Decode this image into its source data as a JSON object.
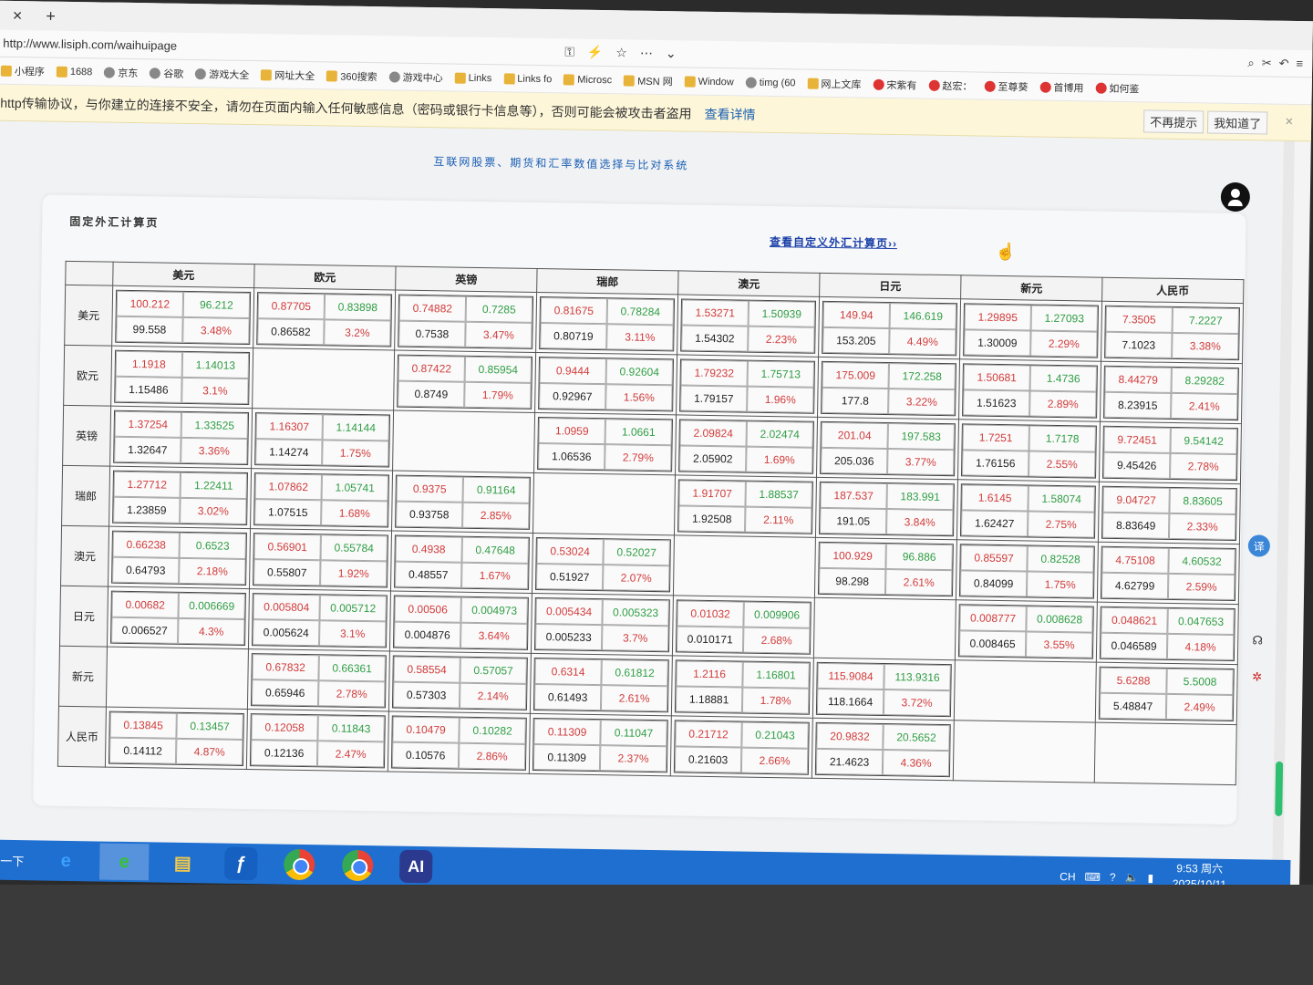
{
  "browser": {
    "tab_close": "×",
    "tab_add": "+",
    "url": "http://www.lisiph.com/waihuipage",
    "address_tools": [
      "⚿",
      "⚡",
      "☆",
      "⋯",
      "⌄"
    ],
    "bookmarks": [
      {
        "label": "小程序",
        "icon": "blue-circle"
      },
      {
        "label": "1688",
        "icon": "orange"
      },
      {
        "label": "京东",
        "icon": "globe"
      },
      {
        "label": "谷歌",
        "icon": "google"
      },
      {
        "label": "游戏大全",
        "icon": "globe"
      },
      {
        "label": "网址大全",
        "icon": "yellow"
      },
      {
        "label": "360搜索",
        "icon": "green"
      },
      {
        "label": "游戏中心",
        "icon": "globe"
      },
      {
        "label": "Links",
        "icon": "folder"
      },
      {
        "label": "Links fo",
        "icon": "folder"
      },
      {
        "label": "Microsc",
        "icon": "folder"
      },
      {
        "label": "MSN 网",
        "icon": "folder"
      },
      {
        "label": "Window",
        "icon": "folder"
      },
      {
        "label": "timg (60",
        "icon": "globe"
      },
      {
        "label": "网上文库",
        "icon": "folder"
      },
      {
        "label": "宋紫有",
        "icon": "weibo"
      },
      {
        "label": "赵宏：",
        "icon": "weibo"
      },
      {
        "label": "至尊葵",
        "icon": "weibo"
      },
      {
        "label": "首博用",
        "icon": "weibo"
      },
      {
        "label": "如何鉴",
        "icon": "weibo"
      }
    ]
  },
  "warning": {
    "text": "http传输协议，与你建立的连接不安全，请勿在页面内输入任何敏感信息（密码或银行卡信息等），否则可能会被攻击者盗用",
    "details": "查看详情",
    "dont_remind": "不再提示",
    "got_it": "我知道了",
    "close": "×"
  },
  "page": {
    "site_title": "互联网股票、期货和汇率数值选择与比对系统",
    "card_title": "固定外汇计算页",
    "custom_link": "查看自定义外汇计算页››"
  },
  "fx_table": {
    "currencies": [
      "美元",
      "欧元",
      "英镑",
      "瑞郎",
      "澳元",
      "日元",
      "新元",
      "人民币"
    ],
    "rows": [
      {
        "name": "美元",
        "cells": [
          {
            "a": "100.212",
            "b": "96.212",
            "c": "99.558",
            "d": "3.48%"
          },
          {
            "a": "0.87705",
            "b": "0.83898",
            "c": "0.86582",
            "d": "3.2%"
          },
          {
            "a": "0.74882",
            "b": "0.7285",
            "c": "0.7538",
            "d": "3.47%"
          },
          {
            "a": "0.81675",
            "b": "0.78284",
            "c": "0.80719",
            "d": "3.11%"
          },
          {
            "a": "1.53271",
            "b": "1.50939",
            "c": "1.54302",
            "d": "2.23%"
          },
          {
            "a": "149.94",
            "b": "146.619",
            "c": "153.205",
            "d": "4.49%"
          },
          {
            "a": "1.29895",
            "b": "1.27093",
            "c": "1.30009",
            "d": "2.29%"
          },
          {
            "a": "7.3505",
            "b": "7.2227",
            "c": "7.1023",
            "d": "3.38%"
          }
        ]
      },
      {
        "name": "欧元",
        "cells": [
          {
            "a": "1.1918",
            "b": "1.14013",
            "c": "1.15486",
            "d": "3.1%"
          },
          null,
          {
            "a": "0.87422",
            "b": "0.85954",
            "c": "0.8749",
            "d": "1.79%"
          },
          {
            "a": "0.9444",
            "b": "0.92604",
            "c": "0.92967",
            "d": "1.56%"
          },
          {
            "a": "1.79232",
            "b": "1.75713",
            "c": "1.79157",
            "d": "1.96%"
          },
          {
            "a": "175.009",
            "b": "172.258",
            "c": "177.8",
            "d": "3.22%"
          },
          {
            "a": "1.50681",
            "b": "1.4736",
            "c": "1.51623",
            "d": "2.89%"
          },
          {
            "a": "8.44279",
            "b": "8.29282",
            "c": "8.23915",
            "d": "2.41%"
          }
        ]
      },
      {
        "name": "英镑",
        "cells": [
          {
            "a": "1.37254",
            "b": "1.33525",
            "c": "1.32647",
            "d": "3.36%"
          },
          {
            "a": "1.16307",
            "b": "1.14144",
            "c": "1.14274",
            "d": "1.75%"
          },
          null,
          {
            "a": "1.0959",
            "b": "1.0661",
            "c": "1.06536",
            "d": "2.79%"
          },
          {
            "a": "2.09824",
            "b": "2.02474",
            "c": "2.05902",
            "d": "1.69%"
          },
          {
            "a": "201.04",
            "b": "197.583",
            "c": "205.036",
            "d": "3.77%"
          },
          {
            "a": "1.7251",
            "b": "1.7178",
            "c": "1.76156",
            "d": "2.55%"
          },
          {
            "a": "9.72451",
            "b": "9.54142",
            "c": "9.45426",
            "d": "2.78%"
          }
        ]
      },
      {
        "name": "瑞郎",
        "cells": [
          {
            "a": "1.27712",
            "b": "1.22411",
            "c": "1.23859",
            "d": "3.02%"
          },
          {
            "a": "1.07862",
            "b": "1.05741",
            "c": "1.07515",
            "d": "1.68%"
          },
          {
            "a": "0.9375",
            "b": "0.91164",
            "c": "0.93758",
            "d": "2.85%"
          },
          null,
          {
            "a": "1.91707",
            "b": "1.88537",
            "c": "1.92508",
            "d": "2.11%"
          },
          {
            "a": "187.537",
            "b": "183.991",
            "c": "191.05",
            "d": "3.84%"
          },
          {
            "a": "1.6145",
            "b": "1.58074",
            "c": "1.62427",
            "d": "2.75%"
          },
          {
            "a": "9.04727",
            "b": "8.83605",
            "c": "8.83649",
            "d": "2.33%"
          }
        ]
      },
      {
        "name": "澳元",
        "cells": [
          {
            "a": "0.66238",
            "b": "0.6523",
            "c": "0.64793",
            "d": "2.18%"
          },
          {
            "a": "0.56901",
            "b": "0.55784",
            "c": "0.55807",
            "d": "1.92%"
          },
          {
            "a": "0.4938",
            "b": "0.47648",
            "c": "0.48557",
            "d": "1.67%"
          },
          {
            "a": "0.53024",
            "b": "0.52027",
            "c": "0.51927",
            "d": "2.07%"
          },
          null,
          {
            "a": "100.929",
            "b": "96.886",
            "c": "98.298",
            "d": "2.61%"
          },
          {
            "a": "0.85597",
            "b": "0.82528",
            "c": "0.84099",
            "d": "1.75%"
          },
          {
            "a": "4.75108",
            "b": "4.60532",
            "c": "4.62799",
            "d": "2.59%"
          }
        ]
      },
      {
        "name": "日元",
        "cells": [
          {
            "a": "0.00682",
            "b": "0.006669",
            "c": "0.006527",
            "d": "4.3%"
          },
          {
            "a": "0.005804",
            "b": "0.005712",
            "c": "0.005624",
            "d": "3.1%"
          },
          {
            "a": "0.00506",
            "b": "0.004973",
            "c": "0.004876",
            "d": "3.64%"
          },
          {
            "a": "0.005434",
            "b": "0.005323",
            "c": "0.005233",
            "d": "3.7%"
          },
          {
            "a": "0.01032",
            "b": "0.009906",
            "c": "0.010171",
            "d": "2.68%"
          },
          null,
          {
            "a": "0.008777",
            "b": "0.008628",
            "c": "0.008465",
            "d": "3.55%"
          },
          {
            "a": "0.048621",
            "b": "0.047653",
            "c": "0.046589",
            "d": "4.18%"
          }
        ]
      },
      {
        "name": "新元",
        "cells": [
          null,
          {
            "a": "0.67832",
            "b": "0.66361",
            "c": "0.65946",
            "d": "2.78%"
          },
          {
            "a": "0.58554",
            "b": "0.57057",
            "c": "0.57303",
            "d": "2.14%"
          },
          {
            "a": "0.6314",
            "b": "0.61812",
            "c": "0.61493",
            "d": "2.61%"
          },
          {
            "a": "1.2116",
            "b": "1.16801",
            "c": "1.18881",
            "d": "1.78%"
          },
          {
            "a": "115.9084",
            "b": "113.9316",
            "c": "118.1664",
            "d": "3.72%"
          },
          null,
          {
            "a": "5.6288",
            "b": "5.5008",
            "c": "5.48847",
            "d": "2.49%"
          }
        ]
      },
      {
        "name": "人民币",
        "cells": [
          {
            "a": "0.13845",
            "b": "0.13457",
            "c": "0.14112",
            "d": "4.87%"
          },
          {
            "a": "0.12058",
            "b": "0.11843",
            "c": "0.12136",
            "d": "2.47%"
          },
          {
            "a": "0.10479",
            "b": "0.10282",
            "c": "0.10576",
            "d": "2.86%"
          },
          {
            "a": "0.11309",
            "b": "0.11047",
            "c": "0.11309",
            "d": "2.37%"
          },
          {
            "a": "0.21712",
            "b": "0.21043",
            "c": "0.21603",
            "d": "2.66%"
          },
          {
            "a": "20.9832",
            "b": "20.5652",
            "c": "21.4623",
            "d": "4.36%"
          },
          null,
          null
        ]
      }
    ]
  },
  "side_buttons": {
    "translate": "译"
  },
  "taskbar": {
    "search": "索一下",
    "apps": [
      {
        "name": "ie-icon",
        "glyph": "e"
      },
      {
        "name": "ie-green-icon",
        "glyph": "e"
      },
      {
        "name": "folder-icon",
        "glyph": "▤"
      },
      {
        "name": "flash-icon",
        "glyph": "ƒ"
      },
      {
        "name": "chrome-icon",
        "glyph": ""
      },
      {
        "name": "chrome-icon",
        "glyph": ""
      },
      {
        "name": "ai-icon",
        "glyph": "AI"
      }
    ],
    "ime": "CH",
    "time": "9:53 周六",
    "date": "2025/10/11"
  }
}
